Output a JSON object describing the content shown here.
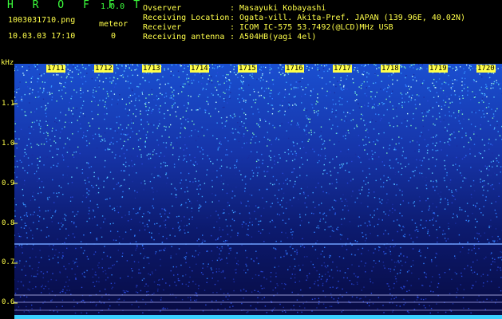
{
  "app": {
    "title": "H R O F F T",
    "version": "1.0.0"
  },
  "capture": {
    "filename": "1003031710.png",
    "timestamp": "10.03.03 17:10",
    "meteor_label": "meteor",
    "meteor_count": "0"
  },
  "info": {
    "observer_label": "Ovserver",
    "observer_value": ": Masayuki Kobayashi",
    "location_label": "Receiving Location",
    "location_value": ": Ogata-vill. Akita-Pref. JAPAN (139.96E, 40.02N)",
    "receiver_label": "Receiver",
    "receiver_value": ": ICOM IC-575 53.7492(@LCD)MHz USB",
    "antenna_label": "Receiving antenna",
    "antenna_value": ": A504HB(yagi 4el)"
  },
  "axis": {
    "unit": "kHz",
    "ticks": [
      "1.1",
      "1.0",
      "0.9",
      "0.8",
      "0.7",
      "0.6"
    ]
  },
  "time_marks": [
    "1711",
    "1712",
    "1713",
    "1714",
    "1715",
    "1716",
    "1717",
    "1718",
    "1719",
    "1720"
  ],
  "colors": {
    "text_green": "#3cff3c",
    "text_yellow": "#ffff4a",
    "background": "#000000",
    "spectrum_base": "#0a0c55"
  }
}
